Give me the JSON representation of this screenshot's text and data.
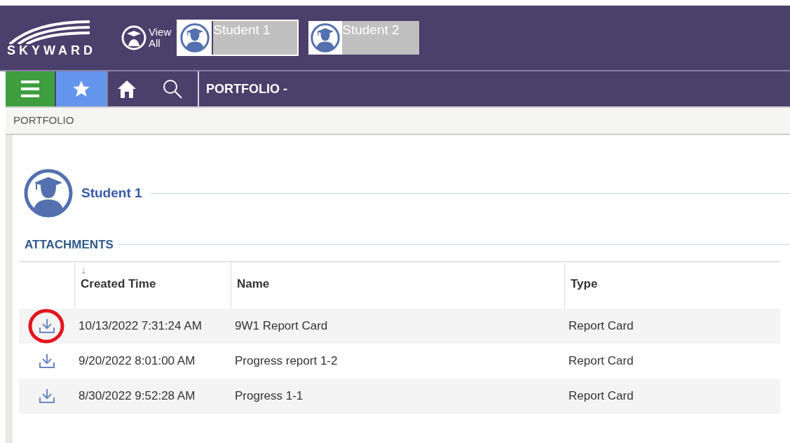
{
  "header": {
    "logo": "SKYWARD",
    "view_all": [
      "View",
      "All"
    ],
    "students": [
      {
        "name": "Student 1",
        "selected": true
      },
      {
        "name": "Student 2",
        "selected": false
      }
    ]
  },
  "nav": {
    "title": "PORTFOLIO -",
    "favorites_selected": true
  },
  "breadcrumb": "PORTFOLIO",
  "student_name": "Student 1",
  "section_title": "ATTACHMENTS",
  "table": {
    "sort_indicator": "↓",
    "columns": [
      "Created Time",
      "Name",
      "Type"
    ],
    "rows": [
      {
        "created": "10/13/2022 7:31:24 AM",
        "name": "9W1 Report Card",
        "type": "Report Card",
        "highlighted": true
      },
      {
        "created": "9/20/2022 8:01:00 AM",
        "name": "Progress report 1-2",
        "type": "Report Card",
        "highlighted": false
      },
      {
        "created": "8/30/2022 9:52:28 AM",
        "name": "Progress 1-1",
        "type": "Report Card",
        "highlighted": false
      }
    ]
  }
}
